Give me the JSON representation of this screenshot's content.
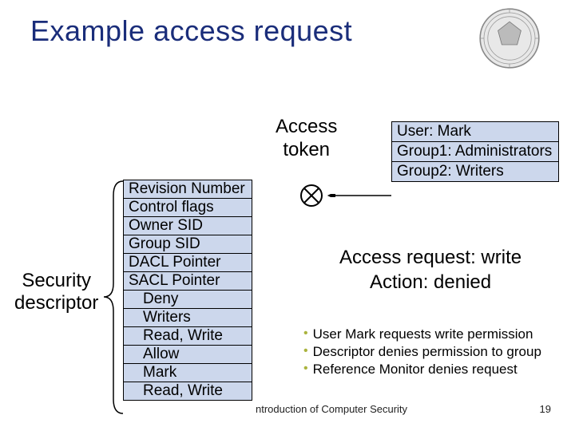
{
  "title": "Example access request",
  "access_token_label": "Access\ntoken",
  "token_rows": [
    "User:      Mark",
    "Group1: Administrators",
    "Group2: Writers"
  ],
  "descriptor": {
    "label": "Security\ndescriptor",
    "rows": [
      {
        "text": "Revision Number",
        "indent": false
      },
      {
        "text": "Control flags",
        "indent": false
      },
      {
        "text": "Owner SID",
        "indent": false
      },
      {
        "text": "Group SID",
        "indent": false
      },
      {
        "text": "DACL Pointer",
        "indent": false
      },
      {
        "text": "SACL Pointer",
        "indent": false
      },
      {
        "text": "Deny",
        "indent": true
      },
      {
        "text": "Writers",
        "indent": true
      },
      {
        "text": "Read, Write",
        "indent": true
      },
      {
        "text": "Allow",
        "indent": true
      },
      {
        "text": "Mark",
        "indent": true
      },
      {
        "text": "Read, Write",
        "indent": true
      }
    ]
  },
  "result": {
    "line1": "Access request: write",
    "line2": "Action: denied"
  },
  "bullets": [
    "User Mark requests write permission",
    "Descriptor denies permission to group",
    "Reference Monitor denies request"
  ],
  "footer": "ntroduction of Computer Security",
  "page": "19"
}
